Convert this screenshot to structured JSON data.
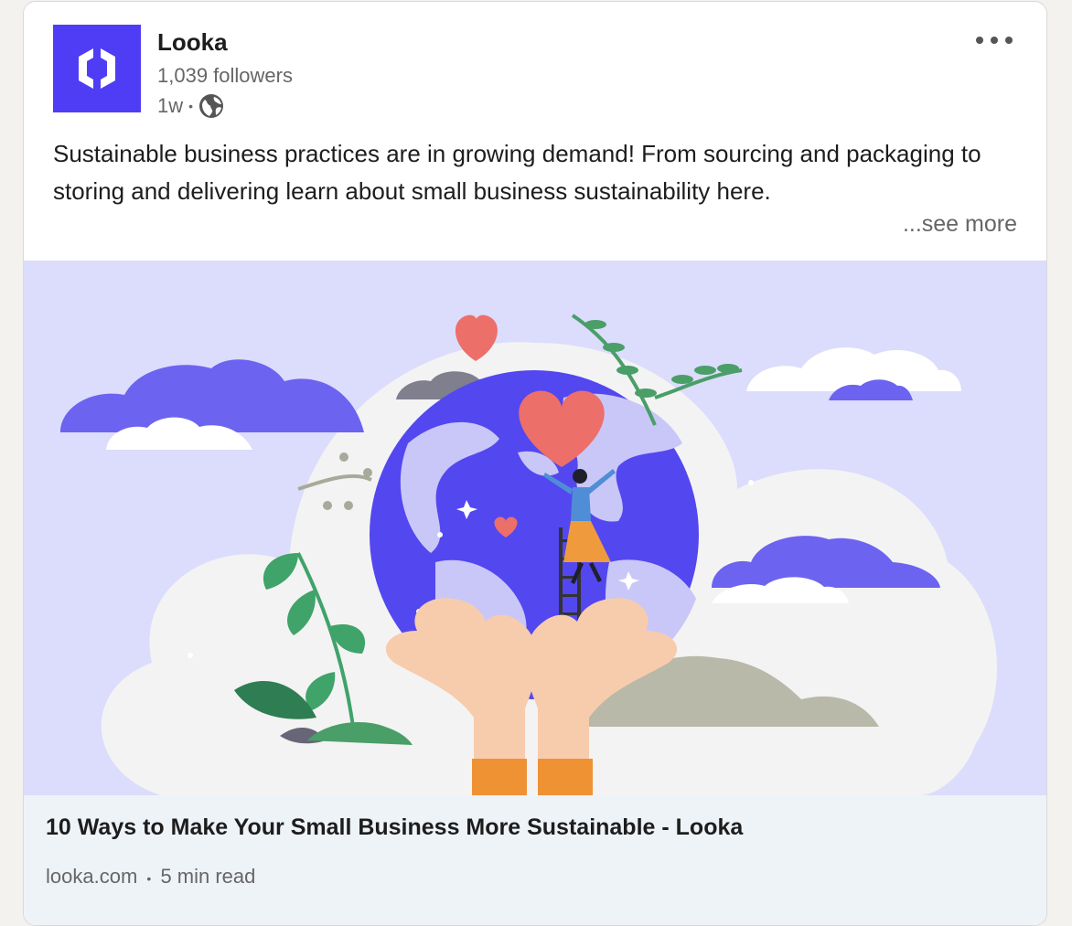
{
  "post": {
    "company": "Looka",
    "followers": "1,039 followers",
    "time": "1w",
    "separator": "•",
    "text": "Sustainable business practices are in growing demand! From sourcing and packaging to storing and delivering learn about small business sustainability here.",
    "see_more": "...see more"
  },
  "link": {
    "title": "10 Ways to Make Your Small Business More Sustainable - Looka",
    "domain": "looka.com",
    "separator": "•",
    "read_time": "5 min read"
  },
  "icons": {
    "logo": "looka-logo",
    "visibility": "globe-icon",
    "more": "more-options-icon"
  },
  "colors": {
    "brand": "#4f3df5",
    "image_background": "#dcdcfc",
    "footer_background": "#eef3f8"
  }
}
